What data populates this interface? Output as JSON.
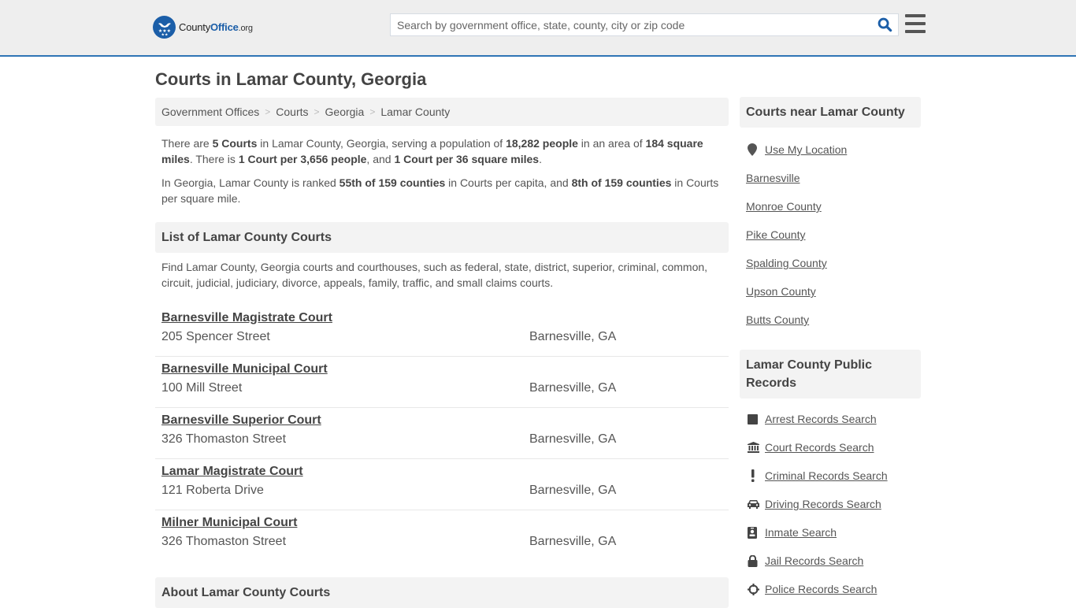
{
  "header": {
    "logo": {
      "name_part1": "County",
      "name_part2": "Office",
      "tld": ".org"
    },
    "search": {
      "placeholder": "Search by government office, state, county, city or zip code",
      "value": ""
    },
    "search_icon": "search-icon",
    "menu_icon": "hamburger-menu-icon"
  },
  "page": {
    "title": "Courts in Lamar County, Georgia"
  },
  "breadcrumb": [
    {
      "label": "Government Offices"
    },
    {
      "label": "Courts"
    },
    {
      "label": "Georgia"
    },
    {
      "label": "Lamar County"
    }
  ],
  "intro": {
    "p1": {
      "t1": "There are ",
      "b1": "5 Courts",
      "t2": " in Lamar County, Georgia, serving a population of ",
      "b2": "18,282 people",
      "t3": " in an area of ",
      "b3": "184 square miles",
      "t4": ". There is ",
      "b4": "1 Court per 3,656 people",
      "t5": ", and ",
      "b5": "1 Court per 36 square miles",
      "t6": "."
    },
    "p2": {
      "t1": "In Georgia, Lamar County is ranked ",
      "b1": "55th of 159 counties",
      "t2": " in Courts per capita, and ",
      "b2": "8th of 159 counties",
      "t3": " in Courts per square mile."
    }
  },
  "list_section": {
    "title": "List of Lamar County Courts",
    "description": "Find Lamar County, Georgia courts and courthouses, such as federal, state, district, superior, criminal, common, circuit, judicial, judiciary, divorce, appeals, family, traffic, and small claims courts.",
    "courts": [
      {
        "name": "Barnesville Magistrate Court",
        "address": "205 Spencer Street",
        "city": "Barnesville, GA"
      },
      {
        "name": "Barnesville Municipal Court",
        "address": "100 Mill Street",
        "city": "Barnesville, GA"
      },
      {
        "name": "Barnesville Superior Court",
        "address": "326 Thomaston Street",
        "city": "Barnesville, GA"
      },
      {
        "name": "Lamar Magistrate Court",
        "address": "121 Roberta Drive",
        "city": "Barnesville, GA"
      },
      {
        "name": "Milner Municipal Court",
        "address": "326 Thomaston Street",
        "city": "Barnesville, GA"
      }
    ]
  },
  "about_section": {
    "title": "About Lamar County Courts"
  },
  "sidebar": {
    "near": {
      "title": "Courts near Lamar County",
      "use_location": {
        "label": "Use My Location",
        "icon": "map-marker-icon"
      },
      "items": [
        {
          "label": "Barnesville"
        },
        {
          "label": "Monroe County"
        },
        {
          "label": "Pike County"
        },
        {
          "label": "Spalding County"
        },
        {
          "label": "Upson County"
        },
        {
          "label": "Butts County"
        }
      ]
    },
    "records": {
      "title": "Lamar County Public Records",
      "items": [
        {
          "label": "Arrest Records Search",
          "icon": "square-icon"
        },
        {
          "label": "Court Records Search",
          "icon": "courthouse-icon"
        },
        {
          "label": "Criminal Records Search",
          "icon": "exclamation-icon"
        },
        {
          "label": "Driving Records Search",
          "icon": "car-icon"
        },
        {
          "label": "Inmate Search",
          "icon": "id-badge-icon"
        },
        {
          "label": "Jail Records Search",
          "icon": "lock-icon"
        },
        {
          "label": "Police Records Search",
          "icon": "crosshairs-icon"
        }
      ]
    }
  },
  "colors": {
    "brand_blue": "#1b5ea8",
    "header_border": "#2f74b5",
    "header_bg": "#eeeeee",
    "section_bg": "#f3f3f3",
    "text": "#555555"
  }
}
